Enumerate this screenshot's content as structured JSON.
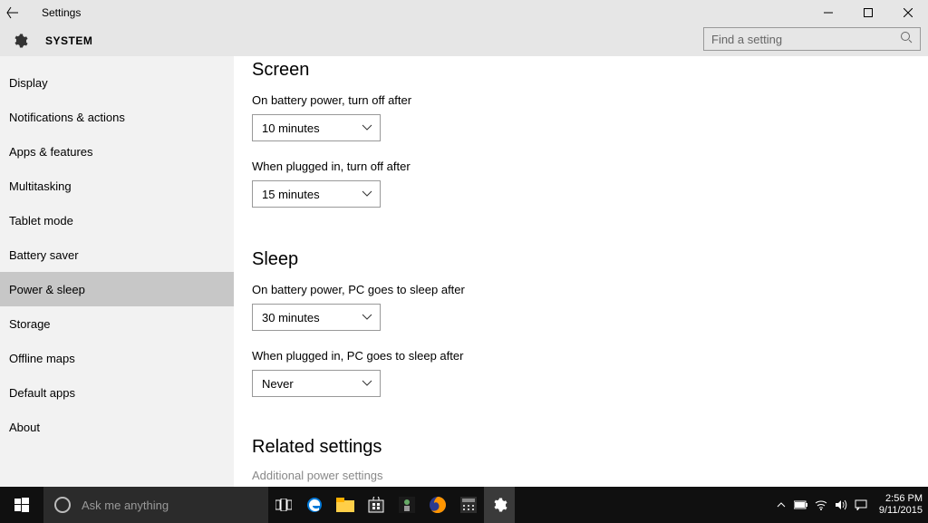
{
  "titlebar": {
    "title": "Settings"
  },
  "header": {
    "system_label": "SYSTEM",
    "search_placeholder": "Find a setting"
  },
  "sidebar": {
    "items": [
      {
        "label": "Display"
      },
      {
        "label": "Notifications & actions"
      },
      {
        "label": "Apps & features"
      },
      {
        "label": "Multitasking"
      },
      {
        "label": "Tablet mode"
      },
      {
        "label": "Battery saver"
      },
      {
        "label": "Power & sleep"
      },
      {
        "label": "Storage"
      },
      {
        "label": "Offline maps"
      },
      {
        "label": "Default apps"
      },
      {
        "label": "About"
      }
    ],
    "selected_index": 6
  },
  "content": {
    "screen": {
      "heading": "Screen",
      "battery_label": "On battery power, turn off after",
      "battery_value": "10 minutes",
      "plugged_label": "When plugged in, turn off after",
      "plugged_value": "15 minutes"
    },
    "sleep": {
      "heading": "Sleep",
      "battery_label": "On battery power, PC goes to sleep after",
      "battery_value": "30 minutes",
      "plugged_label": "When plugged in, PC goes to sleep after",
      "plugged_value": "Never"
    },
    "related": {
      "heading": "Related settings",
      "link1": "Additional power settings"
    }
  },
  "taskbar": {
    "cortana_placeholder": "Ask me anything",
    "clock_time": "2:56 PM",
    "clock_date": "9/11/2015"
  }
}
